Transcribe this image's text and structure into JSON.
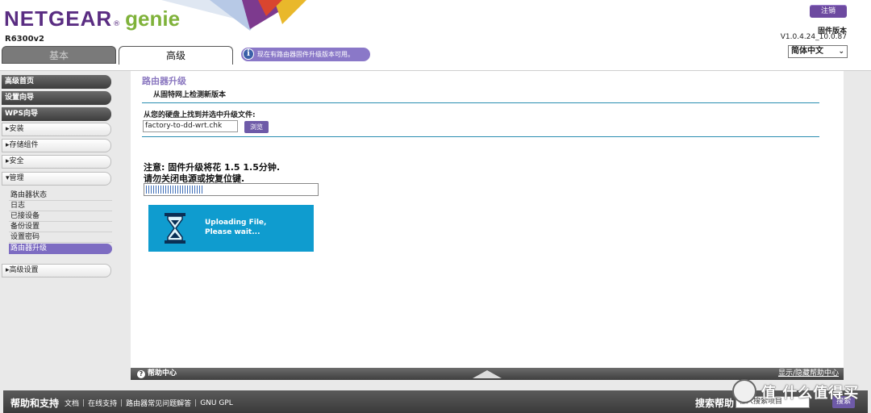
{
  "header": {
    "brand": "NETGEAR",
    "brand_reg": "®",
    "product": "genie",
    "model": "R6300v2",
    "logout_label": "注销",
    "firmware_label": "固件版本",
    "firmware_version": "V1.0.4.24_10.0.87",
    "language": "简体中文",
    "tabs": [
      {
        "label": "基本",
        "active": false
      },
      {
        "label": "高级",
        "active": true
      }
    ],
    "update_banner": "现在有路由器固件升级版本可用。",
    "colors": {
      "brand": "#5a2d82",
      "genie": "#7fb23a",
      "accent": "#6e5aa8"
    }
  },
  "sidebar": {
    "top_items": [
      "高级首页",
      "设置向导",
      "WPS向导"
    ],
    "sections": [
      "安装",
      "存储组件",
      "安全",
      "管理"
    ],
    "management_subitems": [
      "路由器状态",
      "日志",
      "已接设备",
      "备份设置",
      "设置密码",
      "路由器升级"
    ],
    "active_subitem": "路由器升级",
    "bottom_section": "高级设置"
  },
  "main": {
    "title": "路由器升级",
    "section_title": "从固特网上检测新版本",
    "file_label": "从您的硬盘上找到并选中升级文件:",
    "file_value": "factory-to-dd-wrt.chk",
    "browse_label": "浏览",
    "warning_line1": "注意: 固件升级将花 1.5 1.5分钟.",
    "warning_line2": "请勿关闭电源或按复位键.",
    "progress_fraction": 0.33,
    "uploading_line1": "Uploading File,",
    "uploading_line2": "Please wait..."
  },
  "helpbar": {
    "help_center": "帮助中心",
    "toggle": "显示/隐藏帮助中心"
  },
  "footer": {
    "title": "帮助和支持",
    "links": [
      "文档",
      "在线支持",
      "路由器常见问题解答",
      "GNU GPL"
    ],
    "search_label": "搜索帮助",
    "search_placeholder": "输入搜索项目",
    "search_button": "搜索"
  },
  "watermark": {
    "text": "值 什么值得买"
  }
}
